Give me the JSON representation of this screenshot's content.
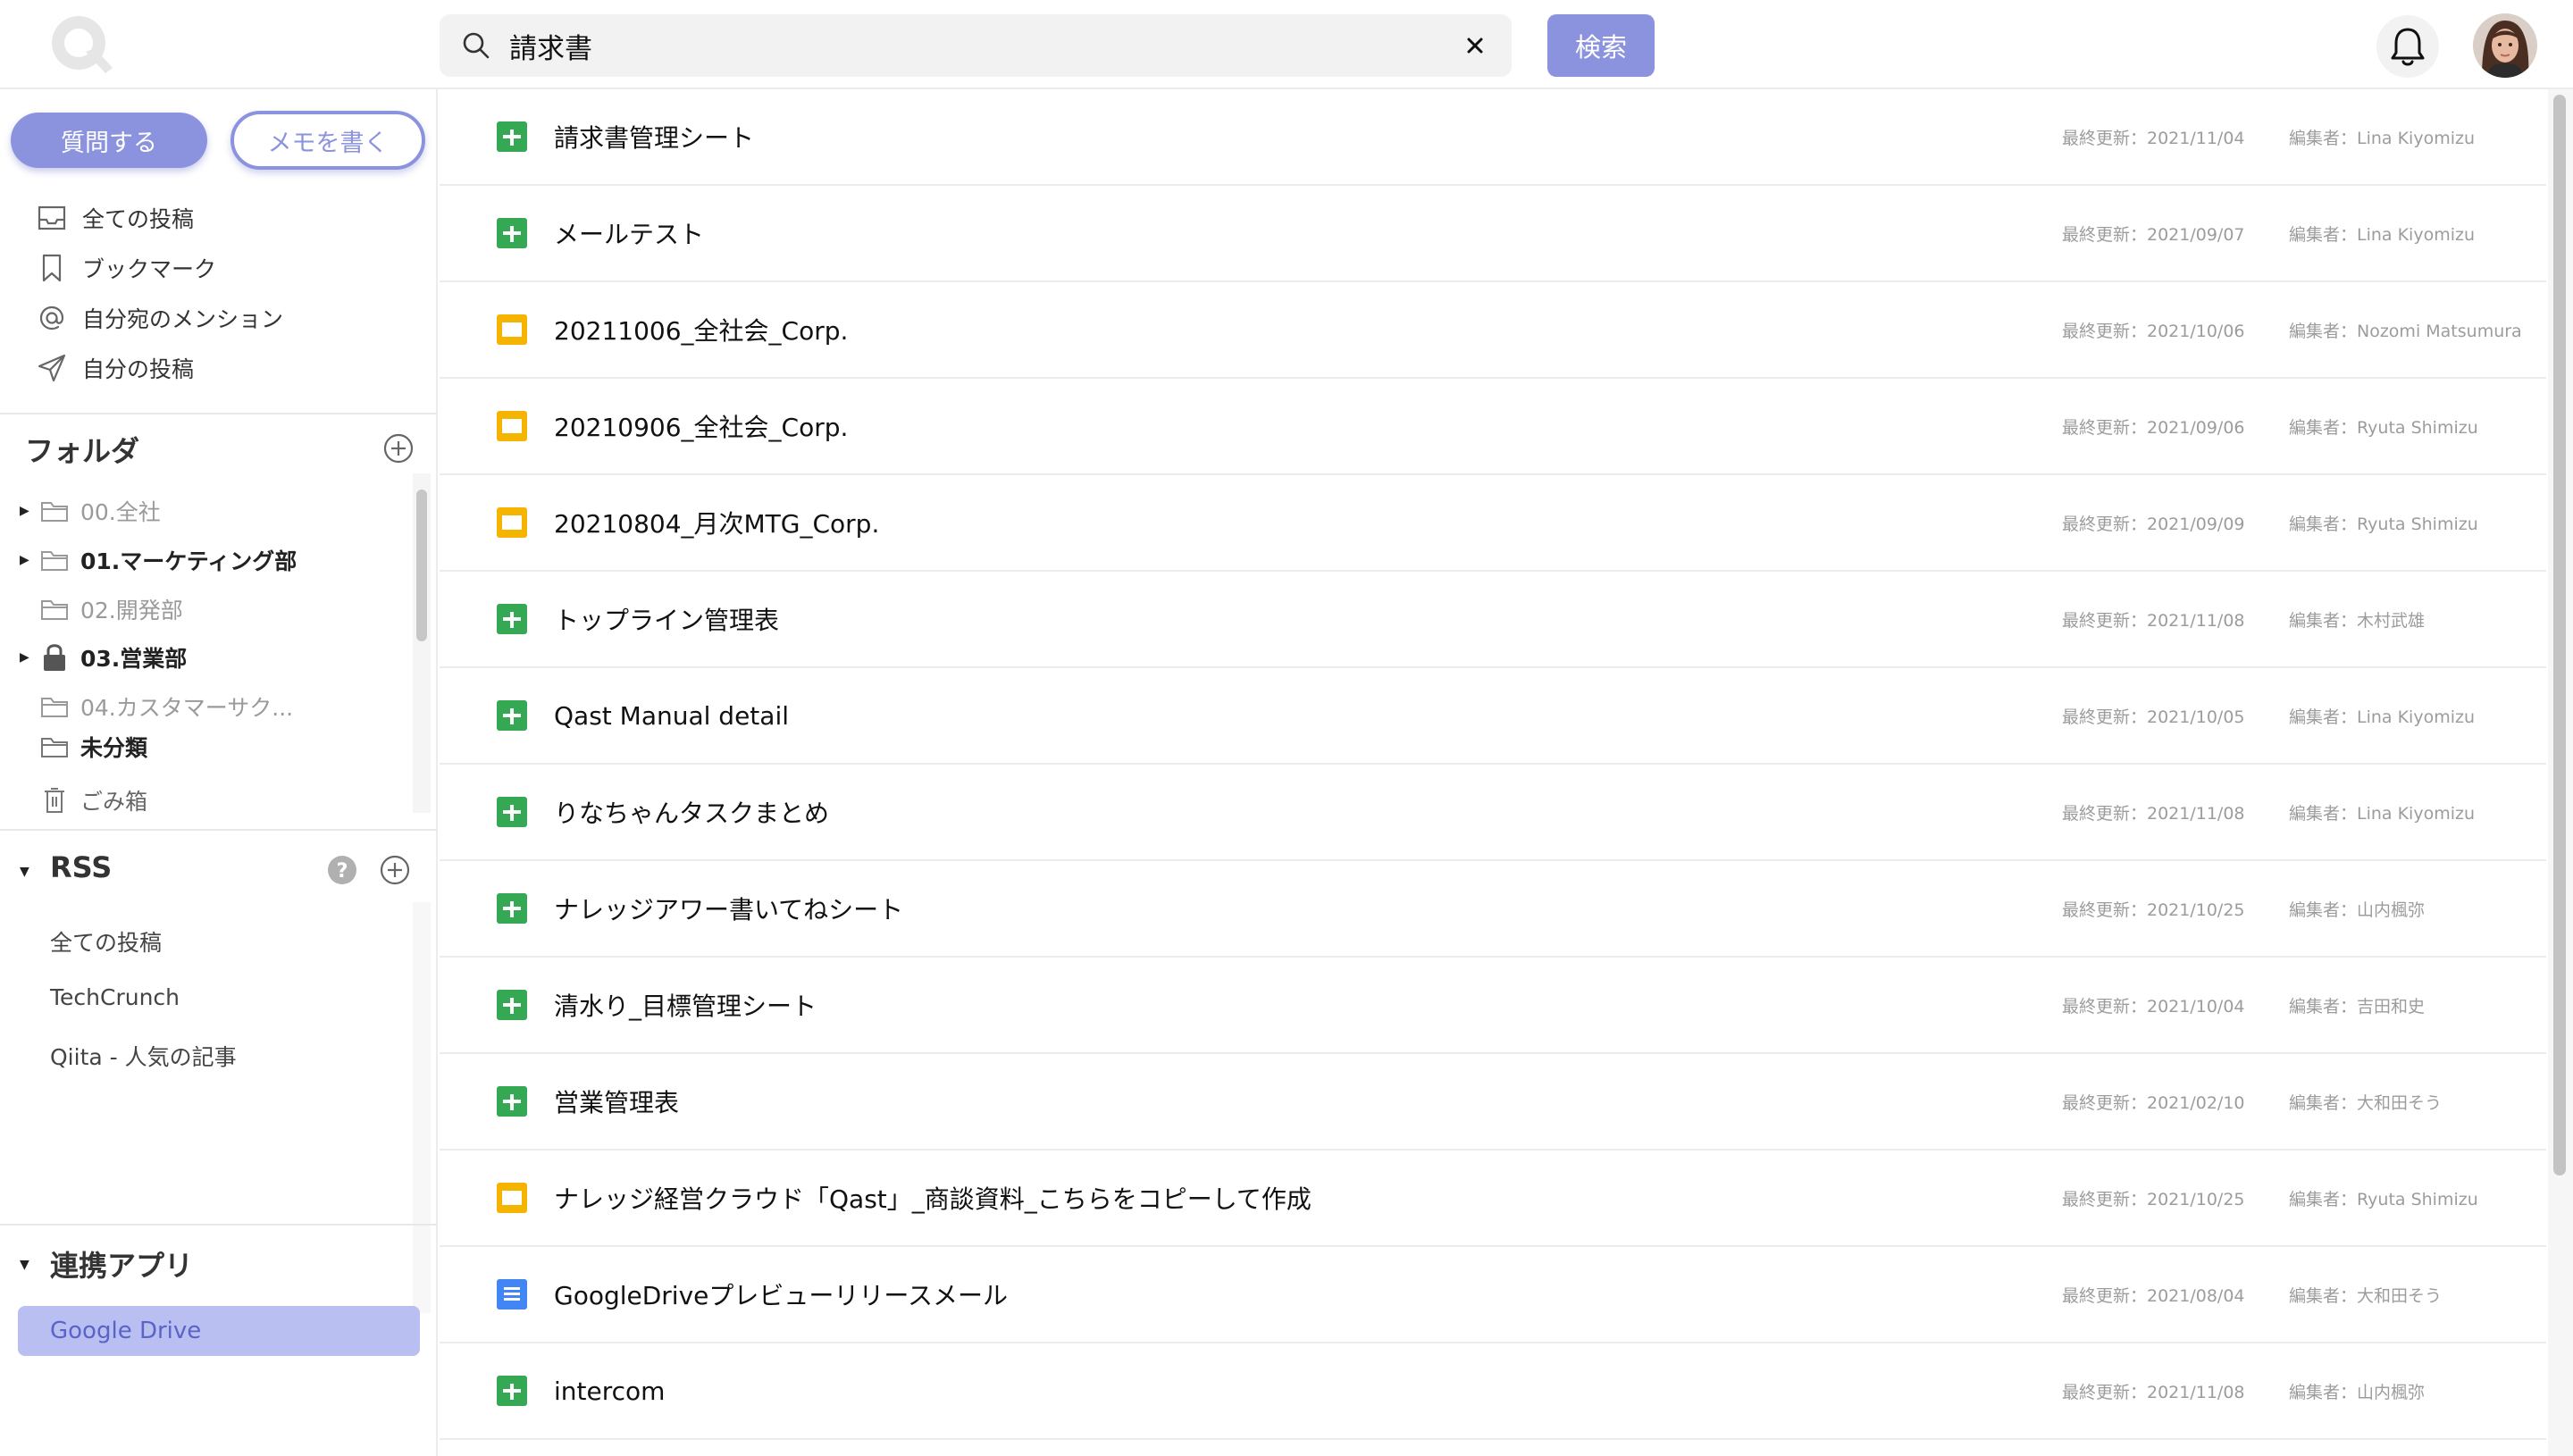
{
  "header": {
    "search": {
      "value": "請求書",
      "placeholder": ""
    },
    "search_button": "検索"
  },
  "sidebar": {
    "ask_button": "質問する",
    "memo_button": "メモを書く",
    "nav": [
      {
        "label": "全ての投稿",
        "icon": "inbox-icon"
      },
      {
        "label": "ブックマーク",
        "icon": "bookmark-icon"
      },
      {
        "label": "自分宛のメンション",
        "icon": "at-icon"
      },
      {
        "label": "自分の投稿",
        "icon": "send-icon"
      }
    ],
    "folders_title": "フォルダ",
    "folders": [
      {
        "label": "00.全社",
        "expandable": true,
        "style": "dim",
        "icon": "folder-icon"
      },
      {
        "label": "01.マーケティング部",
        "expandable": true,
        "style": "bold",
        "icon": "folder-icon"
      },
      {
        "label": "02.開発部",
        "expandable": false,
        "style": "dim",
        "icon": "folder-icon"
      },
      {
        "label": "03.営業部",
        "expandable": true,
        "style": "bold",
        "icon": "lock-icon"
      },
      {
        "label": "04.カスタマーサク...",
        "expandable": false,
        "style": "dim",
        "icon": "folder-icon"
      }
    ],
    "uncategorized": "未分類",
    "trash": "ごみ箱",
    "rss_title": "RSS",
    "rss_items": [
      "全ての投稿",
      "TechCrunch",
      "Qiita - 人気の記事"
    ],
    "apps_title": "連携アプリ",
    "apps": [
      "Google Drive"
    ]
  },
  "results": [
    {
      "title": "請求書管理シート",
      "type": "sheet",
      "updated": "最終更新：2021/11/04",
      "editor": "編集者：Lina Kiyomizu"
    },
    {
      "title": "メールテスト",
      "type": "sheet",
      "updated": "最終更新：2021/09/07",
      "editor": "編集者：Lina Kiyomizu"
    },
    {
      "title": "20211006_全社会_Corp.",
      "type": "slide",
      "updated": "最終更新：2021/10/06",
      "editor": "編集者：Nozomi Matsumura"
    },
    {
      "title": "20210906_全社会_Corp.",
      "type": "slide",
      "updated": "最終更新：2021/09/06",
      "editor": "編集者：Ryuta Shimizu"
    },
    {
      "title": "20210804_月次MTG_Corp.",
      "type": "slide",
      "updated": "最終更新：2021/09/09",
      "editor": "編集者：Ryuta Shimizu"
    },
    {
      "title": "トップライン管理表",
      "type": "sheet",
      "updated": "最終更新：2021/11/08",
      "editor": "編集者：木村武雄"
    },
    {
      "title": "Qast Manual detail",
      "type": "sheet",
      "updated": "最終更新：2021/10/05",
      "editor": "編集者：Lina Kiyomizu"
    },
    {
      "title": "りなちゃんタスクまとめ",
      "type": "sheet",
      "updated": "最終更新：2021/11/08",
      "editor": "編集者：Lina Kiyomizu"
    },
    {
      "title": "ナレッジアワー書いてねシート",
      "type": "sheet",
      "updated": "最終更新：2021/10/25",
      "editor": "編集者：山内楓弥"
    },
    {
      "title": "清水り_目標管理シート",
      "type": "sheet",
      "updated": "最終更新：2021/10/04",
      "editor": "編集者：吉田和史"
    },
    {
      "title": "営業管理表",
      "type": "sheet",
      "updated": "最終更新：2021/02/10",
      "editor": "編集者：大和田そう"
    },
    {
      "title": "ナレッジ経営クラウド「Qast」_商談資料_こちらをコピーして作成",
      "type": "slide",
      "updated": "最終更新：2021/10/25",
      "editor": "編集者：Ryuta Shimizu"
    },
    {
      "title": "GoogleDriveプレビューリリースメール",
      "type": "doc",
      "updated": "最終更新：2021/08/04",
      "editor": "編集者：大和田そう"
    },
    {
      "title": "intercom",
      "type": "sheet",
      "updated": "最終更新：2021/11/08",
      "editor": "編集者：山内楓弥"
    }
  ],
  "colors": {
    "accent": "#8b93de",
    "sheet": "#34a853",
    "slide": "#f4b400",
    "doc": "#4285f4"
  }
}
